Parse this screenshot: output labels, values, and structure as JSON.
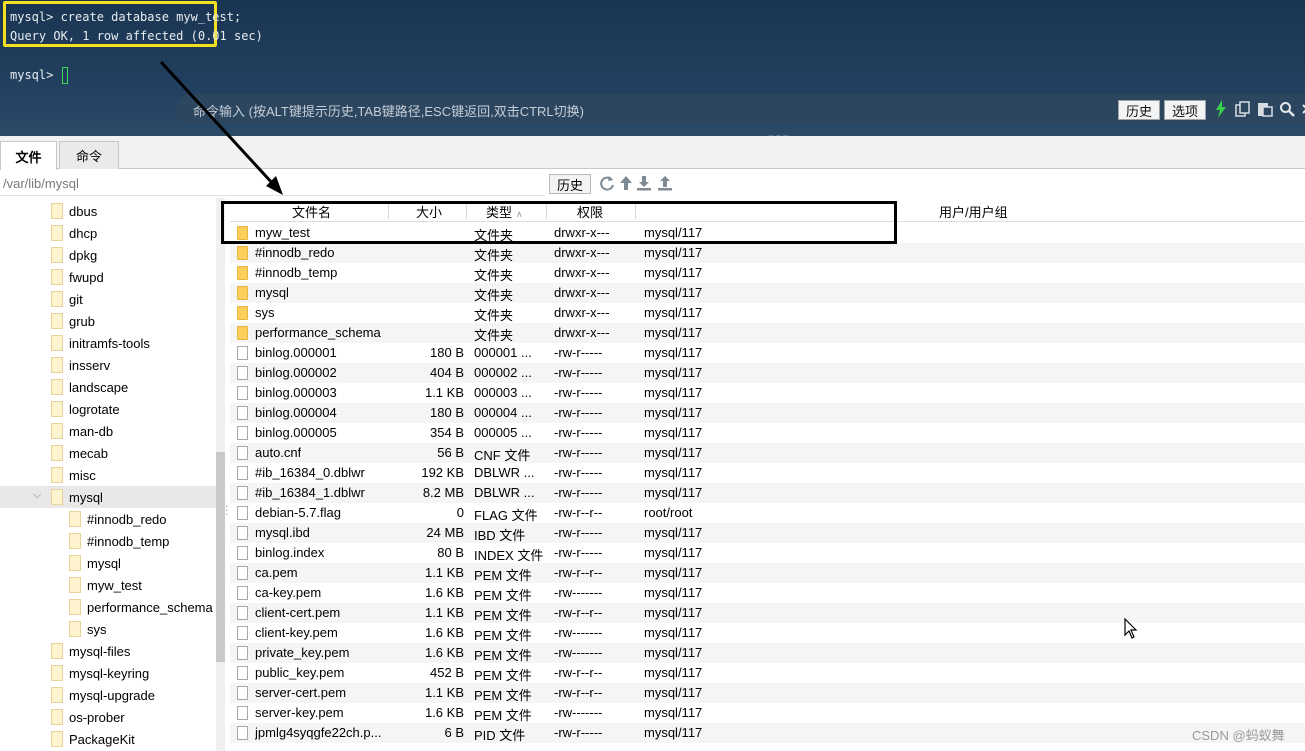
{
  "terminal": {
    "lines": [
      "mysql> create database myw_test;",
      "Query OK, 1 row affected (0.01 sec)",
      "",
      "mysql> "
    ],
    "command_hint": "命令输入 (按ALT键提示历史,TAB键路径,ESC键返回,双击CTRL切换)",
    "history_button": "历史",
    "options_button": "选项",
    "icons": [
      "lightning-icon",
      "copy-icon",
      "paste-icon",
      "search-icon",
      "close-icon"
    ]
  },
  "tabs": [
    {
      "label": "文件",
      "active": true
    },
    {
      "label": "命令",
      "active": false
    }
  ],
  "pathbar": {
    "path": "/var/lib/mysql",
    "history_button": "历史",
    "icons": [
      "refresh-icon",
      "up-dir-icon",
      "download-icon",
      "upload-icon"
    ]
  },
  "tree": {
    "items": [
      {
        "label": "dbus",
        "depth": 0
      },
      {
        "label": "dhcp",
        "depth": 0
      },
      {
        "label": "dpkg",
        "depth": 0
      },
      {
        "label": "fwupd",
        "depth": 0
      },
      {
        "label": "git",
        "depth": 0
      },
      {
        "label": "grub",
        "depth": 0
      },
      {
        "label": "initramfs-tools",
        "depth": 0
      },
      {
        "label": "insserv",
        "depth": 0
      },
      {
        "label": "landscape",
        "depth": 0
      },
      {
        "label": "logrotate",
        "depth": 0
      },
      {
        "label": "man-db",
        "depth": 0
      },
      {
        "label": "mecab",
        "depth": 0
      },
      {
        "label": "misc",
        "depth": 0
      },
      {
        "label": "mysql",
        "depth": 0,
        "expanded": true,
        "selected": true
      },
      {
        "label": "#innodb_redo",
        "depth": 1
      },
      {
        "label": "#innodb_temp",
        "depth": 1
      },
      {
        "label": "mysql",
        "depth": 1
      },
      {
        "label": "myw_test",
        "depth": 1
      },
      {
        "label": "performance_schema",
        "depth": 1
      },
      {
        "label": "sys",
        "depth": 1
      },
      {
        "label": "mysql-files",
        "depth": 0
      },
      {
        "label": "mysql-keyring",
        "depth": 0
      },
      {
        "label": "mysql-upgrade",
        "depth": 0
      },
      {
        "label": "os-prober",
        "depth": 0
      },
      {
        "label": "PackageKit",
        "depth": 0
      }
    ]
  },
  "table": {
    "headers": {
      "name": "文件名",
      "size": "大小",
      "type": "类型",
      "perm": "权限",
      "owner": "用户/用户组"
    },
    "rows": [
      {
        "icon": "folder",
        "name": "myw_test",
        "size": "",
        "type": "文件夹",
        "perm": "drwxr-x---",
        "owner": "mysql/117"
      },
      {
        "icon": "folder",
        "name": "#innodb_redo",
        "size": "",
        "type": "文件夹",
        "perm": "drwxr-x---",
        "owner": "mysql/117"
      },
      {
        "icon": "folder",
        "name": "#innodb_temp",
        "size": "",
        "type": "文件夹",
        "perm": "drwxr-x---",
        "owner": "mysql/117"
      },
      {
        "icon": "folder",
        "name": "mysql",
        "size": "",
        "type": "文件夹",
        "perm": "drwxr-x---",
        "owner": "mysql/117"
      },
      {
        "icon": "folder",
        "name": "sys",
        "size": "",
        "type": "文件夹",
        "perm": "drwxr-x---",
        "owner": "mysql/117"
      },
      {
        "icon": "folder",
        "name": "performance_schema",
        "size": "",
        "type": "文件夹",
        "perm": "drwxr-x---",
        "owner": "mysql/117"
      },
      {
        "icon": "file",
        "name": "binlog.000001",
        "size": "180 B",
        "type": "000001 ...",
        "perm": "-rw-r-----",
        "owner": "mysql/117"
      },
      {
        "icon": "file",
        "name": "binlog.000002",
        "size": "404 B",
        "type": "000002 ...",
        "perm": "-rw-r-----",
        "owner": "mysql/117"
      },
      {
        "icon": "file",
        "name": "binlog.000003",
        "size": "1.1 KB",
        "type": "000003 ...",
        "perm": "-rw-r-----",
        "owner": "mysql/117"
      },
      {
        "icon": "file",
        "name": "binlog.000004",
        "size": "180 B",
        "type": "000004 ...",
        "perm": "-rw-r-----",
        "owner": "mysql/117"
      },
      {
        "icon": "file",
        "name": "binlog.000005",
        "size": "354 B",
        "type": "000005 ...",
        "perm": "-rw-r-----",
        "owner": "mysql/117"
      },
      {
        "icon": "file",
        "name": "auto.cnf",
        "size": "56 B",
        "type": "CNF 文件",
        "perm": "-rw-r-----",
        "owner": "mysql/117"
      },
      {
        "icon": "file",
        "name": "#ib_16384_0.dblwr",
        "size": "192 KB",
        "type": "DBLWR ...",
        "perm": "-rw-r-----",
        "owner": "mysql/117"
      },
      {
        "icon": "file",
        "name": "#ib_16384_1.dblwr",
        "size": "8.2 MB",
        "type": "DBLWR ...",
        "perm": "-rw-r-----",
        "owner": "mysql/117"
      },
      {
        "icon": "file",
        "name": "debian-5.7.flag",
        "size": "0",
        "type": "FLAG 文件",
        "perm": "-rw-r--r--",
        "owner": "root/root"
      },
      {
        "icon": "file",
        "name": "mysql.ibd",
        "size": "24 MB",
        "type": "IBD 文件",
        "perm": "-rw-r-----",
        "owner": "mysql/117"
      },
      {
        "icon": "file",
        "name": "binlog.index",
        "size": "80 B",
        "type": "INDEX 文件",
        "perm": "-rw-r-----",
        "owner": "mysql/117"
      },
      {
        "icon": "file",
        "name": "ca.pem",
        "size": "1.1 KB",
        "type": "PEM 文件",
        "perm": "-rw-r--r--",
        "owner": "mysql/117"
      },
      {
        "icon": "file",
        "name": "ca-key.pem",
        "size": "1.6 KB",
        "type": "PEM 文件",
        "perm": "-rw-------",
        "owner": "mysql/117"
      },
      {
        "icon": "file",
        "name": "client-cert.pem",
        "size": "1.1 KB",
        "type": "PEM 文件",
        "perm": "-rw-r--r--",
        "owner": "mysql/117"
      },
      {
        "icon": "file",
        "name": "client-key.pem",
        "size": "1.6 KB",
        "type": "PEM 文件",
        "perm": "-rw-------",
        "owner": "mysql/117"
      },
      {
        "icon": "file",
        "name": "private_key.pem",
        "size": "1.6 KB",
        "type": "PEM 文件",
        "perm": "-rw-------",
        "owner": "mysql/117"
      },
      {
        "icon": "file",
        "name": "public_key.pem",
        "size": "452 B",
        "type": "PEM 文件",
        "perm": "-rw-r--r--",
        "owner": "mysql/117"
      },
      {
        "icon": "file",
        "name": "server-cert.pem",
        "size": "1.1 KB",
        "type": "PEM 文件",
        "perm": "-rw-r--r--",
        "owner": "mysql/117"
      },
      {
        "icon": "file",
        "name": "server-key.pem",
        "size": "1.6 KB",
        "type": "PEM 文件",
        "perm": "-rw-------",
        "owner": "mysql/117"
      },
      {
        "icon": "file",
        "name": "jpmlg4syqgfe22ch.p...",
        "size": "6 B",
        "type": "PID 文件",
        "perm": "-rw-r-----",
        "owner": "mysql/117"
      }
    ]
  },
  "watermark": "CSDN @蚂蚁舞",
  "colors": {
    "terminal_bg": "#1f3a58",
    "highlight_yellow": "#f4e01e",
    "cursor_green": "#3ddc52",
    "folder": "#fbcf5b",
    "annotation": "#000000"
  }
}
